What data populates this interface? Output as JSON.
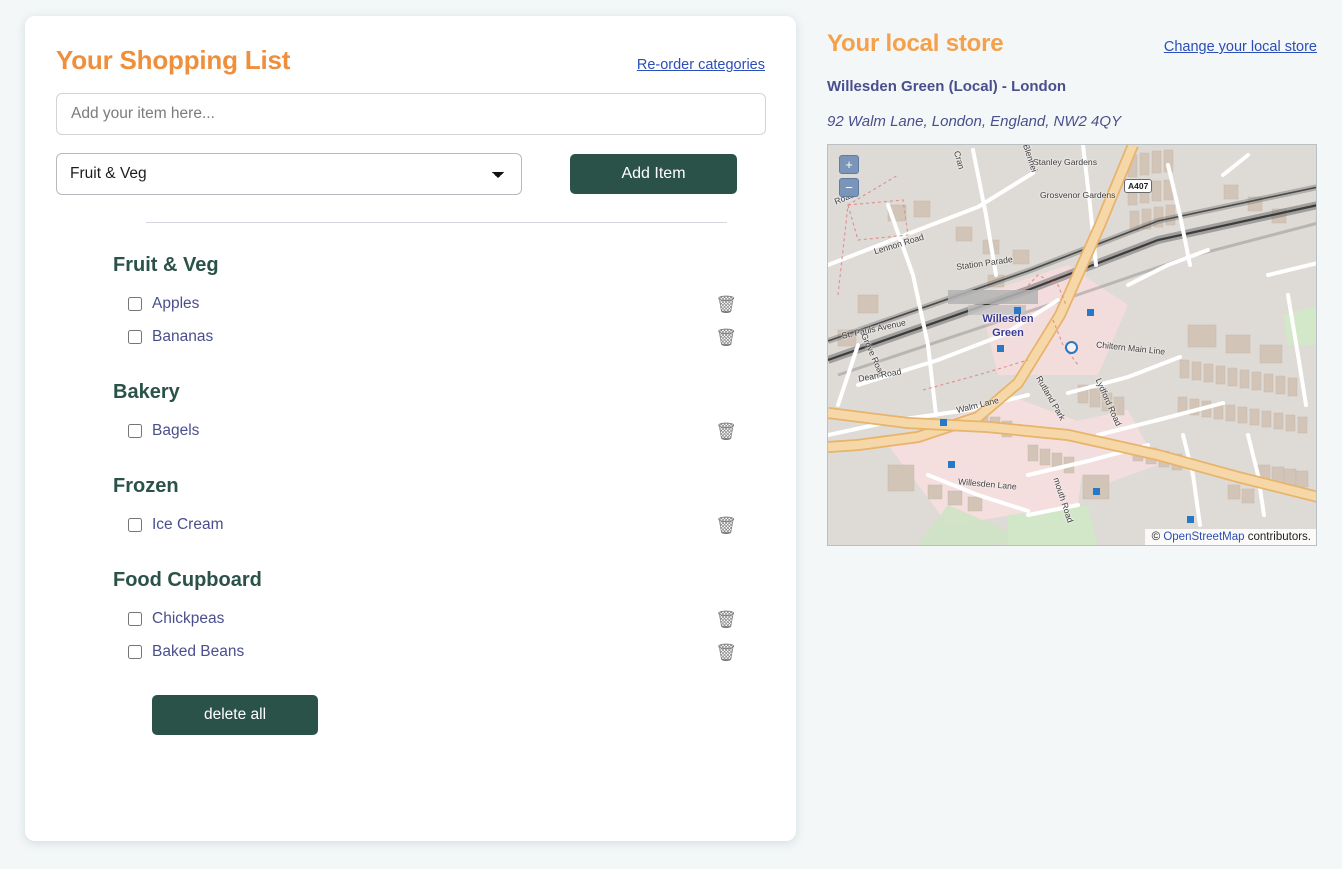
{
  "shopping_list": {
    "title": "Your Shopping List",
    "reorder_link": "Re-order categories",
    "input_placeholder": "Add your item here...",
    "input_value": "",
    "category_selected": "Fruit & Veg",
    "category_options": [
      "Fruit & Veg",
      "Bakery",
      "Frozen",
      "Food Cupboard"
    ],
    "add_button": "Add Item",
    "delete_all_button": "delete all",
    "trash_icon": "🗑",
    "categories": [
      {
        "name": "Fruit & Veg",
        "items": [
          {
            "label": "Apples",
            "checked": false
          },
          {
            "label": "Bananas",
            "checked": false
          }
        ]
      },
      {
        "name": "Bakery",
        "items": [
          {
            "label": "Bagels",
            "checked": false
          }
        ]
      },
      {
        "name": "Frozen",
        "items": [
          {
            "label": "Ice Cream",
            "checked": false
          }
        ]
      },
      {
        "name": "Food Cupboard",
        "items": [
          {
            "label": "Chickpeas",
            "checked": false
          },
          {
            "label": "Baked Beans",
            "checked": false
          }
        ]
      }
    ]
  },
  "local_store": {
    "title": "Your local store",
    "change_link": "Change your local store",
    "name": "Willesden Green (Local) - London",
    "address": "92 Walm Lane, London, England, NW2 4QY",
    "map": {
      "zoom_in": "+",
      "zoom_out": "−",
      "attribution_prefix": "©",
      "attribution_link": "OpenStreetMap",
      "attribution_suffix": "contributors.",
      "place_label_line1": "Willesden",
      "place_label_line2": "Green",
      "road_shield": "A407",
      "street_labels": [
        "Stanley Gardens",
        "Grosvenor Gardens",
        "Lennon Road",
        "Station Parade",
        "St. Pauls Avenue",
        "Grove Road",
        "Dean Road",
        "Walm Lane",
        "Rutland Park",
        "Chiltern Main Line",
        "Willesden Lane",
        "Lydford Road",
        "Cran",
        "Blenhei",
        "Road",
        "mouth Road"
      ]
    }
  },
  "colors": {
    "accent_orange": "#ef8f3c",
    "brand_green": "#2a5248",
    "link_blue": "#2b4eb8",
    "item_text": "#4a4f8c",
    "page_bg": "#f3f7f8"
  }
}
